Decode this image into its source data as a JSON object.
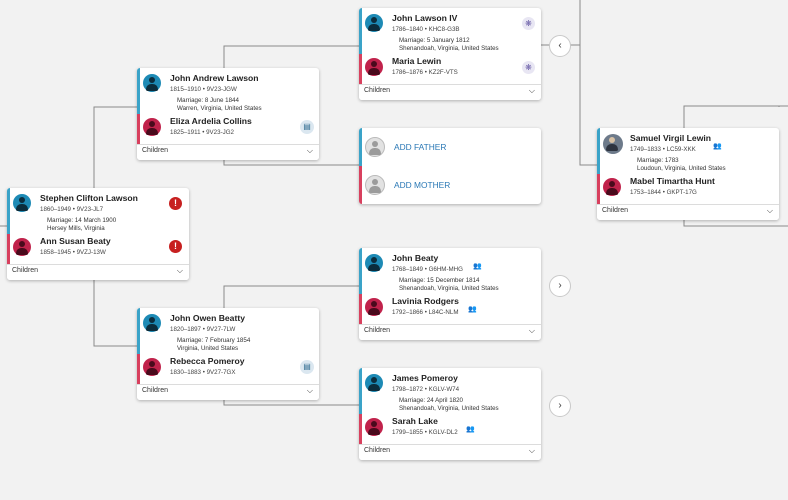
{
  "children_label": "Children",
  "icons": {
    "alert": "!",
    "chevron_down": "⌵",
    "chevron_left": "‹",
    "chevron_right": "›",
    "research_hint": "❋",
    "record_hint": "▤",
    "group": "👥"
  },
  "colors": {
    "male": "#3aa3c8",
    "female": "#d8405e",
    "link": "#2a78b5",
    "alert": "#c72020"
  },
  "couples": {
    "stephen_ann": {
      "husband": {
        "name": "Stephen Clifton Lawson",
        "info": "1860–1949 • 9V23-JL7"
      },
      "marriage": {
        "line1": "Marriage: 14 March 1900",
        "line2": "Hersey Mills, Virginia"
      },
      "wife": {
        "name": "Ann Susan Beaty",
        "info": "1858–1945 • 9VZJ-13W"
      }
    },
    "john_eliza": {
      "husband": {
        "name": "John Andrew Lawson",
        "info": "1815–1910 • 9V23-JGW"
      },
      "marriage": {
        "line1": "Marriage: 8 June 1844",
        "line2": "Warren, Virginia, United States"
      },
      "wife": {
        "name": "Eliza Ardelia Collins",
        "info": "1825–1911 • 9V23-JG2"
      }
    },
    "johnowen_rebecca": {
      "husband": {
        "name": "John Owen Beatty",
        "info": "1820–1897 • 9V27-7LW"
      },
      "marriage": {
        "line1": "Marriage: 7 February 1854",
        "line2": "Virginia, United States"
      },
      "wife": {
        "name": "Rebecca Pomeroy",
        "info": "1830–1883 • 9V27-7GX"
      }
    },
    "johnlawson_maria": {
      "husband": {
        "name": "John Lawson IV",
        "info": "1786–1840 • KHC8-G3B"
      },
      "marriage": {
        "line1": "Marriage: 5 January 1812",
        "line2": "Shenandoah, Virginia, United States"
      },
      "wife": {
        "name": "Maria Lewin",
        "info": "1786–1876 • KZ2F-VTS"
      }
    },
    "add_parents": {
      "father": "ADD FATHER",
      "mother": "ADD MOTHER"
    },
    "johnbeaty_lavinia": {
      "husband": {
        "name": "John Beaty",
        "info": "1768–1849 • G6HM-MHG"
      },
      "marriage": {
        "line1": "Marriage: 15 December 1814",
        "line2": "Shenandoah, Virginia, United States"
      },
      "wife": {
        "name": "Lavinia Rodgers",
        "info": "1792–1866 • L84C-NLM"
      }
    },
    "james_sarah": {
      "husband": {
        "name": "James Pomeroy",
        "info": "1798–1872 • KGLV-W74"
      },
      "marriage": {
        "line1": "Marriage: 24 April 1820",
        "line2": "Shenandoah, Virginia, United States"
      },
      "wife": {
        "name": "Sarah Lake",
        "info": "1799–1855 • KGLV-DL2"
      }
    },
    "samuel_mabel": {
      "husband": {
        "name": "Samuel Virgil Lewin",
        "info": "1749–1833 • LC59-XKK"
      },
      "marriage": {
        "line1": "Marriage: 1783",
        "line2": "Loudoun, Virginia, United States"
      },
      "wife": {
        "name": "Mabel Timartha Hunt",
        "info": "1753–1844 • GKPT-17G"
      }
    }
  }
}
